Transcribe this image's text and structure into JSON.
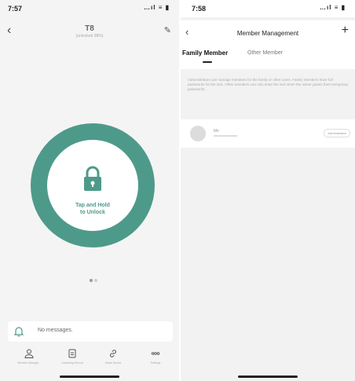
{
  "left": {
    "status": {
      "time": "7:57",
      "system": "…ıl ≡ ▮"
    },
    "header": {
      "title": "T8",
      "subtitle": "(unlocked 98%)"
    },
    "lock_button": {
      "label_line1": "Tap and Hold",
      "label_line2": "to Unlock"
    },
    "message_bar": {
      "text": "No messages."
    },
    "tabbar": {
      "items": [
        {
          "label": "Member Manage...",
          "icon": "person-icon"
        },
        {
          "label": "Unlocking Record",
          "icon": "record-icon"
        },
        {
          "label": "Share Device",
          "icon": "link-icon"
        },
        {
          "label": "Settings",
          "icon": "more-icon"
        }
      ]
    }
  },
  "right": {
    "status": {
      "time": "7:58",
      "system": "…ıl ≡ ▮"
    },
    "header": {
      "title": "Member Management"
    },
    "tabs": [
      {
        "label": "Family Member",
        "active": true
      },
      {
        "label": "Other Member",
        "active": false
      }
    ],
    "notice": "Administrators can manage members for the family or other users. Family members have full passwords for the lock. Other members can only enter the lock when the owner grants them temporary passwords.",
    "member": {
      "name": "Me",
      "role": "Administrator"
    }
  },
  "colors": {
    "accent": "#4e9a8a"
  }
}
